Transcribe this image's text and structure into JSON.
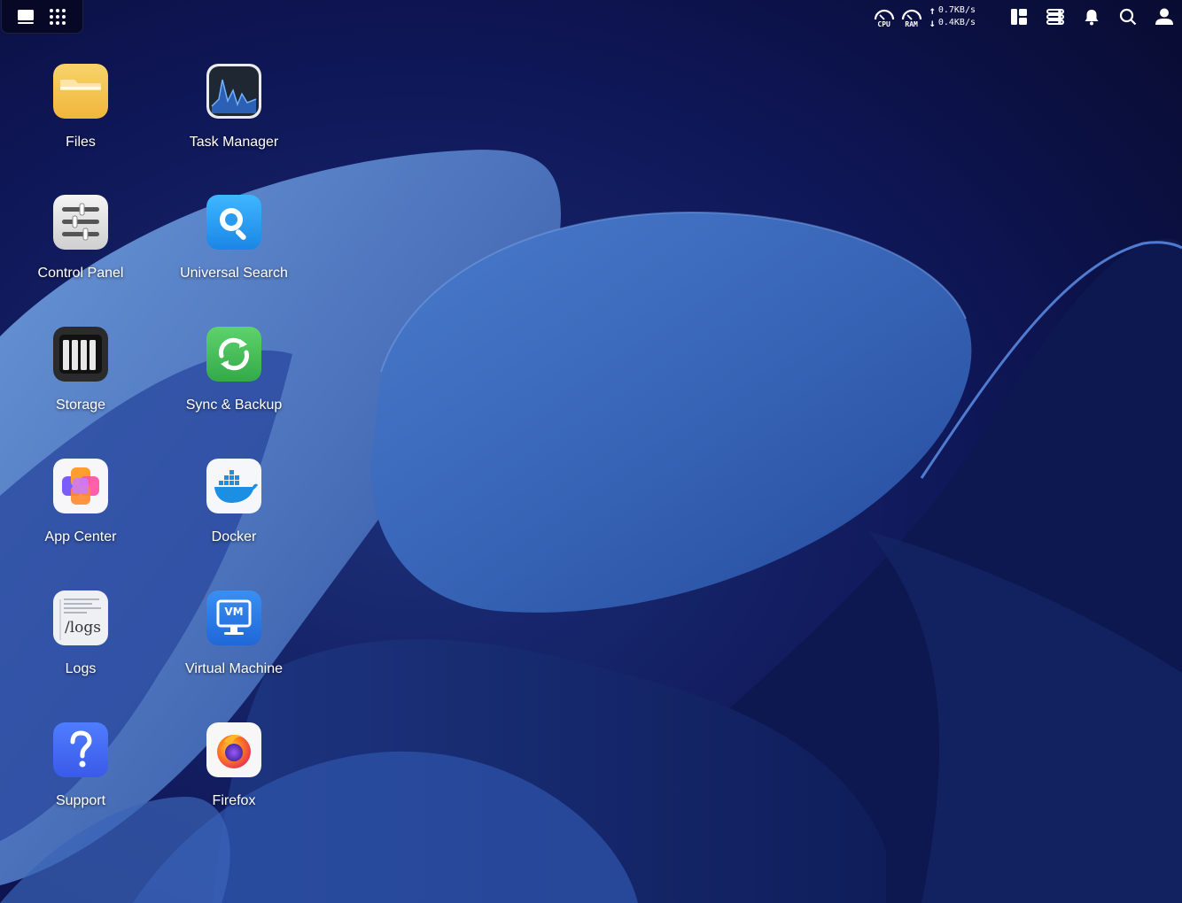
{
  "topbar": {
    "left_icons": [
      "show-desktop-icon",
      "app-launcher-icon"
    ],
    "cpu_label": "CPU",
    "ram_label": "RAM",
    "upload_speed": "0.7KB/s",
    "download_speed": "0.4KB/s",
    "right_icons": [
      "widgets-icon",
      "task-list-icon",
      "notification-bell-icon",
      "search-icon",
      "user-icon"
    ]
  },
  "desktop": {
    "apps": [
      {
        "label": "Files"
      },
      {
        "label": "Task Manager"
      },
      {
        "label": "Control Panel"
      },
      {
        "label": "Universal Search"
      },
      {
        "label": "Storage"
      },
      {
        "label": "Sync & Backup"
      },
      {
        "label": "App Center"
      },
      {
        "label": "Docker"
      },
      {
        "label": "Logs",
        "icon_text": "/logs"
      },
      {
        "label": "Virtual Machine",
        "icon_text": "VM"
      },
      {
        "label": "Support"
      },
      {
        "label": "Firefox"
      }
    ]
  },
  "colors": {
    "background": "#0b0a33",
    "wallpaper_blue": "#3d6bbd"
  }
}
